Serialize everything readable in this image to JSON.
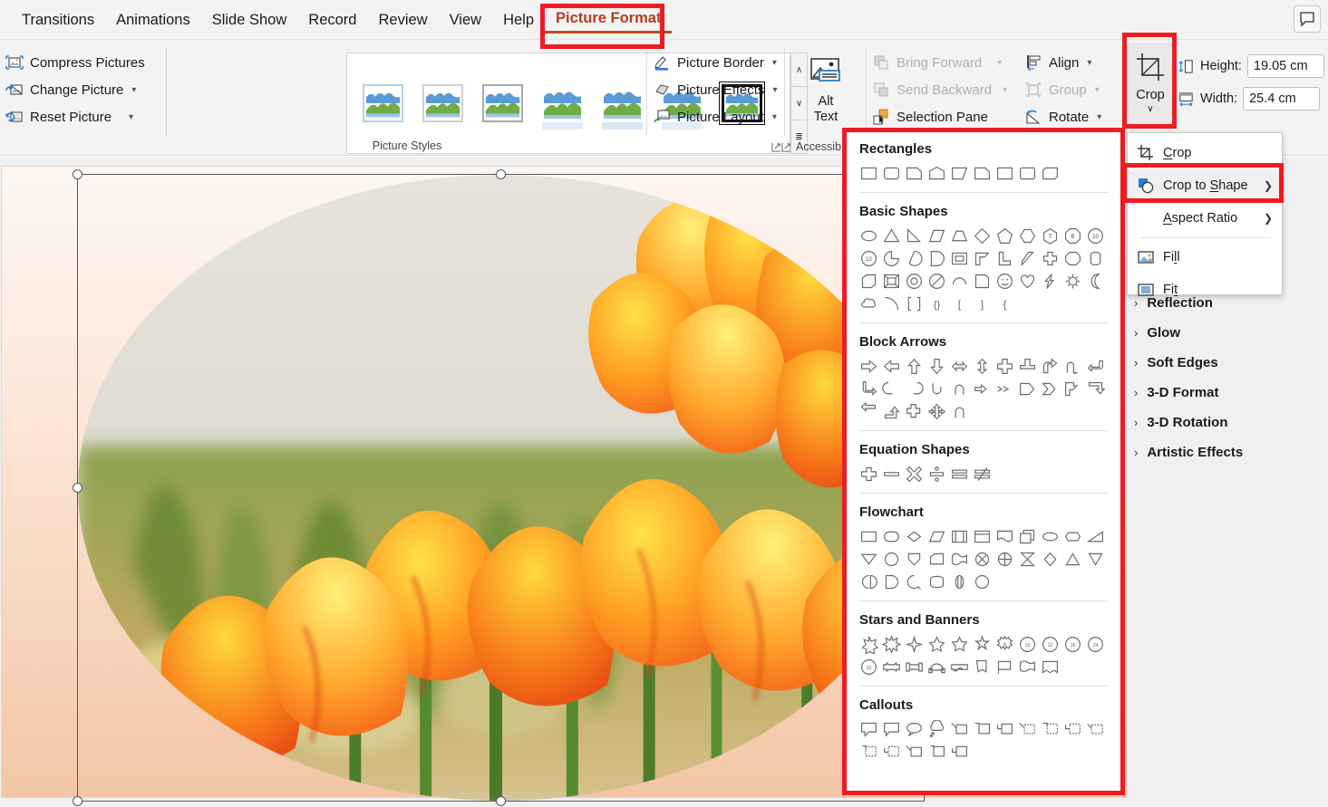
{
  "tabs": [
    {
      "label": "Transitions",
      "active": false
    },
    {
      "label": "Animations",
      "active": false
    },
    {
      "label": "Slide Show",
      "active": false
    },
    {
      "label": "Record",
      "active": false
    },
    {
      "label": "Review",
      "active": false
    },
    {
      "label": "View",
      "active": false
    },
    {
      "label": "Help",
      "active": false
    },
    {
      "label": "Picture Format",
      "active": true
    }
  ],
  "titlebar": {
    "comment_icon": "comment-icon"
  },
  "ribbon": {
    "adjust": {
      "items": [
        {
          "label": "Compress Pictures",
          "icon": "compress-pictures-icon",
          "dropdown": false,
          "disabled": false
        },
        {
          "label": "Change Picture",
          "icon": "change-picture-icon",
          "dropdown": true,
          "disabled": false
        },
        {
          "label": "Reset Picture",
          "icon": "reset-picture-icon",
          "dropdown": true,
          "disabled": false
        }
      ]
    },
    "picture_styles": {
      "group_label": "Picture Styles",
      "thumb_count": 7,
      "selected_index": 6,
      "scroll_up": "∧",
      "scroll_down": "∨",
      "more": "≣"
    },
    "picture_format_cmds": [
      {
        "label": "Picture Border",
        "icon": "picture-border-icon",
        "dropdown": true
      },
      {
        "label": "Picture Effects",
        "icon": "picture-effects-icon",
        "dropdown": true
      },
      {
        "label": "Picture Layout",
        "icon": "picture-layout-icon",
        "dropdown": true
      }
    ],
    "accessibility": {
      "alt_text_line1": "Alt",
      "alt_text_line2": "Text",
      "group_label": "Accessib",
      "dialog_launcher": "dialog-launcher-icon"
    },
    "arrange": [
      {
        "label": "Bring Forward",
        "icon": "bring-forward-icon",
        "dropdown": true,
        "disabled": true
      },
      {
        "label": "Send Backward",
        "icon": "send-backward-icon",
        "dropdown": true,
        "disabled": true
      },
      {
        "label": "Selection Pane",
        "icon": "selection-pane-icon",
        "dropdown": false,
        "disabled": false
      },
      {
        "label": "Align",
        "icon": "align-icon",
        "dropdown": true,
        "disabled": false
      },
      {
        "label": "Group",
        "icon": "group-icon",
        "dropdown": true,
        "disabled": true
      },
      {
        "label": "Rotate",
        "icon": "rotate-icon",
        "dropdown": true,
        "disabled": false
      }
    ],
    "size": {
      "crop_label": "Crop",
      "crop_dropdown_glyph": "∨",
      "height_label": "Height:",
      "height_value": "19.05 cm",
      "width_label": "Width:",
      "width_value": "25.4 cm"
    }
  },
  "crop_menu": {
    "items": [
      {
        "label": "Crop",
        "icon": "crop-icon",
        "submenu": false,
        "highlighted": false,
        "underline": "C"
      },
      {
        "label": "Crop to Shape",
        "icon": "crop-to-shape-icon",
        "submenu": true,
        "highlighted": true,
        "underline": "S"
      },
      {
        "label": "Aspect Ratio",
        "icon": null,
        "submenu": true,
        "highlighted": false,
        "underline": "A"
      },
      {
        "label": "Fill",
        "icon": "fill-icon",
        "submenu": false,
        "highlighted": false,
        "underline": "l"
      },
      {
        "label": "Fit",
        "icon": "fit-icon",
        "submenu": false,
        "highlighted": false,
        "underline": "t"
      }
    ],
    "submenu_arrow": "❯"
  },
  "shapes_panel": {
    "sections": [
      {
        "title": "Rectangles",
        "count": 9
      },
      {
        "title": "Basic Shapes",
        "count": 40
      },
      {
        "title": "Block Arrows",
        "count": 27
      },
      {
        "title": "Equation Shapes",
        "count": 6
      },
      {
        "title": "Flowchart",
        "count": 28
      },
      {
        "title": "Stars and Banners",
        "count": 20
      },
      {
        "title": "Callouts",
        "count": 16
      }
    ]
  },
  "side_panel": {
    "items": [
      {
        "label": "Reflection",
        "chevron": "›"
      },
      {
        "label": "Glow",
        "chevron": "›"
      },
      {
        "label": "Soft Edges",
        "chevron": "›"
      },
      {
        "label": "3-D Format",
        "chevron": "›"
      },
      {
        "label": "3-D Rotation",
        "chevron": "›"
      },
      {
        "label": "Artistic Effects",
        "chevron": "›"
      }
    ]
  },
  "slide": {
    "picture_name": "tulips-picture",
    "crop_shape": "oval",
    "selection_handles": 8,
    "background_gradient_top": "#fdf6f1",
    "background_gradient_bottom": "#f3c5a6"
  },
  "colors": {
    "highlight_red": "#ee1c22",
    "active_tab": "#b83b1d",
    "ribbon_bg": "#f3f3f3"
  }
}
